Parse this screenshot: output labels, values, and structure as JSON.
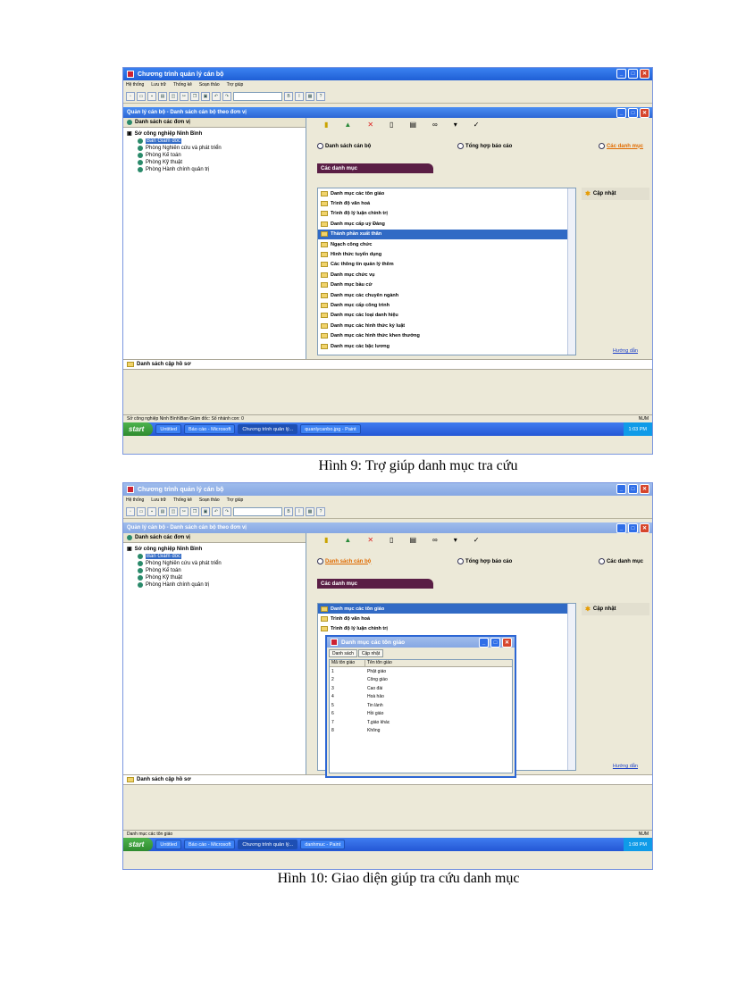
{
  "shot1": {
    "title": "Chương trình quản lý cán bộ",
    "menu": [
      "Hệ thống",
      "Lưu trữ",
      "Thống kê",
      "Soạn thảo",
      "Trợ giúp"
    ],
    "inner_title": "Quản lý cán bộ - Danh sách cán bộ theo đơn vị",
    "left_header": "Danh sách các đơn vị",
    "tree_root": "Sở công nghiệp Ninh Bình",
    "tree_items": [
      "Ban Giám đốc",
      "Phòng Nghiên cứu và phát triển",
      "Phòng Kế toán",
      "Phòng Kỹ thuật",
      "Phòng Hành chính quản trị"
    ],
    "radios": [
      "Danh sách cán bộ",
      "Tổng hợp báo cáo",
      "Các danh mục"
    ],
    "tab": "Các danh mục",
    "categories": [
      "Danh mục các tôn giáo",
      "Trình độ văn hoá",
      "Trình độ lý luận chính trị",
      "Danh mục cấp uỷ Đảng",
      "Thành phần xuất thân",
      "Ngạch công chức",
      "Hình thức tuyển dụng",
      "Các thông tin quản lý thêm",
      "Danh mục chức vụ",
      "Danh mục bầu cử",
      "Danh mục các chuyên ngành",
      "Danh mục cấp công trình",
      "Danh mục các loại danh hiệu",
      "Danh mục các hình thức kỷ luật",
      "Danh mục các hình thức khen thưởng",
      "Danh mục các bậc lương"
    ],
    "selected_category": 4,
    "action": "Cập nhật",
    "help": "Hướng dẫn",
    "bottom_header": "Danh sách cập hồ sơ",
    "status_left": "Sở công nghiệp Ninh Bình\\Ban Giám đốc: Số nhánh con: 0",
    "status_right": "NUM",
    "start": "start",
    "tasks": [
      "Untitled",
      "Báo cáo - Microsoft",
      "Chương trình quản lý...",
      "quanlycanbo.jpg - Paint"
    ],
    "clock": "1:03 PM",
    "caption": "Hình 9: Trợ giúp danh mục tra cứu"
  },
  "shot2": {
    "title": "Chương trình quản lý cán bộ",
    "menu": [
      "Hệ thống",
      "Lưu trữ",
      "Thống kê",
      "Soạn thảo",
      "Trợ giúp"
    ],
    "inner_title": "Quản lý cán bộ - Danh sách cán bộ theo đơn vị",
    "left_header": "Danh sách các đơn vị",
    "tree_root": "Sở công nghiệp Ninh Bình",
    "tree_items": [
      "Ban Giám đốc",
      "Phòng Nghiên cứu và phát triển",
      "Phòng Kế toán",
      "Phòng Kỹ thuật",
      "Phòng Hành chính quản trị"
    ],
    "radios": [
      "Danh sách cán bộ",
      "Tổng hợp báo cáo",
      "Các danh mục"
    ],
    "tab": "Các danh mục",
    "categories": [
      "Danh mục các tôn giáo",
      "Trình độ văn hoá",
      "Trình độ lý luận chính trị"
    ],
    "action": "Cập nhật",
    "help": "Hướng dẫn",
    "dialog": {
      "title": "Danh mục các tôn giáo",
      "tabs": [
        "Danh sách",
        "Cập nhật"
      ],
      "columns": [
        "Mã tôn giáo",
        "Tên tôn giáo"
      ],
      "rows": [
        [
          "1",
          "Phật giáo"
        ],
        [
          "2",
          "Công giáo"
        ],
        [
          "3",
          "Cao đài"
        ],
        [
          "4",
          "Hoà hảo"
        ],
        [
          "5",
          "Tin lành"
        ],
        [
          "6",
          "Hồi giáo"
        ],
        [
          "7",
          "T.giáo khác"
        ],
        [
          "8",
          "Không"
        ]
      ]
    },
    "bottom_header": "Danh sách cập hồ sơ",
    "status_left": "Danh mục các tôn giáo",
    "status_right": "NUM",
    "start": "start",
    "tasks": [
      "Untitled",
      "Báo cáo - Microsoft",
      "Chương trình quản lý...",
      "danhmuc - Paint"
    ],
    "clock": "1:08 PM",
    "caption": "Hình 10: Giao diện giúp tra cứu danh mục"
  }
}
